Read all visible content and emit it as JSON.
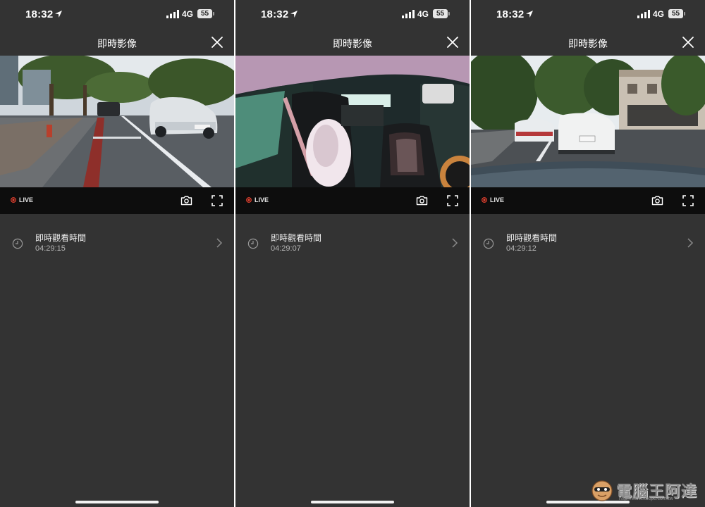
{
  "panels": [
    {
      "status": {
        "time": "18:32",
        "network": "4G",
        "battery": "55"
      },
      "header": {
        "title": "即時影像"
      },
      "player": {
        "live_label": "LIVE",
        "view": "front"
      },
      "row": {
        "label": "即時觀看時間",
        "time": "04:29:15"
      }
    },
    {
      "status": {
        "time": "18:32",
        "network": "4G",
        "battery": "55"
      },
      "header": {
        "title": "即時影像"
      },
      "player": {
        "live_label": "LIVE",
        "view": "cabin"
      },
      "row": {
        "label": "即時觀看時間",
        "time": "04:29:07"
      }
    },
    {
      "status": {
        "time": "18:32",
        "network": "4G",
        "battery": "55"
      },
      "header": {
        "title": "即時影像"
      },
      "player": {
        "live_label": "LIVE",
        "view": "rear"
      },
      "row": {
        "label": "即時觀看時間",
        "time": "04:29:12"
      }
    }
  ],
  "icons": [
    "location-arrow-icon",
    "signal-bars-icon",
    "battery-icon",
    "close-icon",
    "live-dot-icon",
    "camera-icon",
    "fullscreen-icon",
    "clock-icon",
    "chevron-right-icon"
  ],
  "colors": {
    "background": "#333333",
    "control_bar": "#0d0d0d",
    "live_dot": "#e8412f"
  },
  "watermark": {
    "text": "電腦王阿達",
    "url": "http://www.kocpc.com.tw"
  }
}
